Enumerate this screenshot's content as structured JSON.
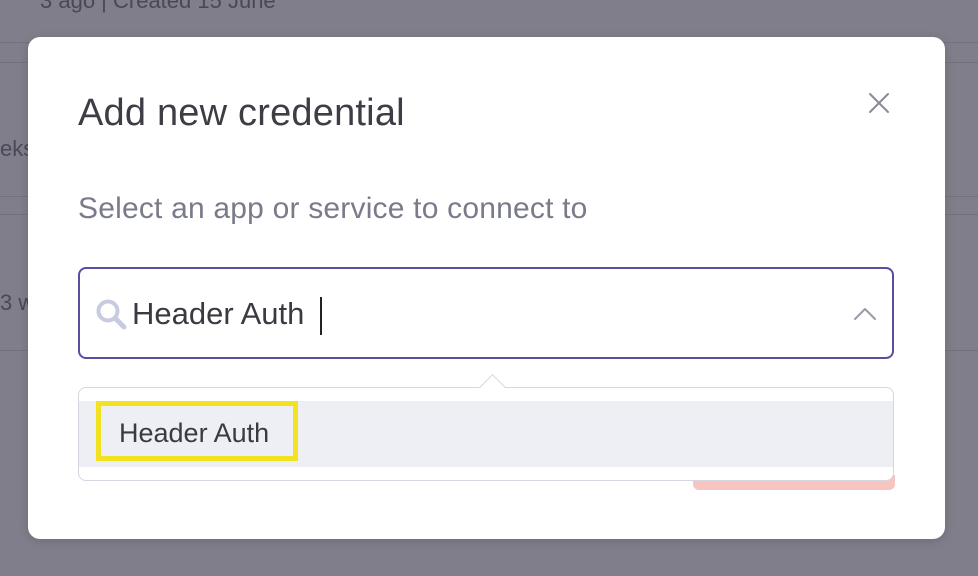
{
  "background": {
    "snippets": [
      "3 ago | Created 15 June",
      "eks",
      "3 w"
    ]
  },
  "modal": {
    "title": "Add new credential",
    "subtitle": "Select an app or service to connect to",
    "close_icon": "close-icon"
  },
  "search": {
    "value": "Header Auth",
    "icon": "search-icon",
    "toggle_icon": "chevron-up-icon"
  },
  "dropdown": {
    "options": [
      {
        "label": "Header Auth",
        "highlighted": true
      }
    ]
  },
  "colors": {
    "accent_border": "#5b4da2",
    "highlight": "#f2e21f",
    "option_bg": "#eeeff4",
    "button_peek": "#f7c4bf"
  }
}
